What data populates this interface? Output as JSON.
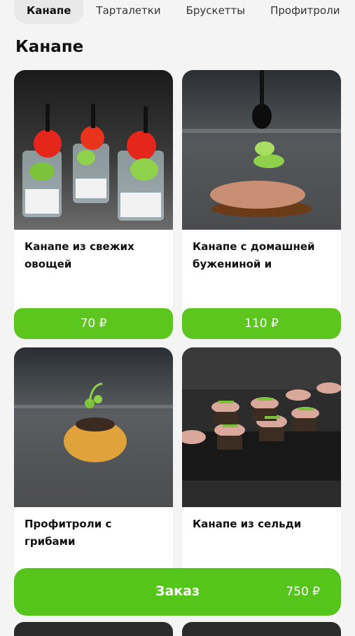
{
  "tabs": [
    "Канапе",
    "Тарталетки",
    "Брускетты",
    "Профитроли"
  ],
  "section_title": "Канапе",
  "products": [
    {
      "name": "Канапе из свежих овощей",
      "price": "70 ₽"
    },
    {
      "name": "Канапе с домашней бужениной и",
      "price": "110 ₽"
    },
    {
      "name": "Профитроли с грибами",
      "price": ""
    },
    {
      "name": "Канапе из сельди",
      "price": ""
    }
  ],
  "order": {
    "label": "Заказ",
    "total": "750 ₽"
  },
  "colors": {
    "accent": "#5cc61f",
    "background": "#f4f4f4"
  }
}
